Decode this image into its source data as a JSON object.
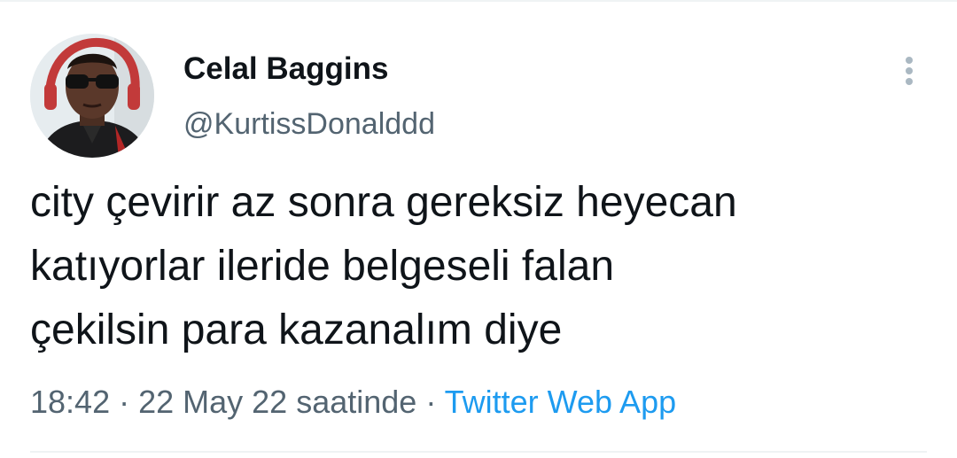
{
  "tweet": {
    "author_name": "Celal Baggins",
    "author_handle": "@KurtissDonalddd",
    "text": "city çevirir az sonra gereksiz heyecan\nkatıyorlar ileride belgeseli falan\nçekilsin para kazanalım diye",
    "time": "18:42",
    "separator": " · ",
    "date": "22 May 22 saatinde",
    "source": "Twitter Web App"
  },
  "icons": {
    "more": "more-vertical-icon",
    "avatar": "profile-photo"
  },
  "colors": {
    "text_primary": "#0f1419",
    "text_secondary": "#536471",
    "link": "#1d9bf0",
    "divider": "#eff3f4"
  }
}
